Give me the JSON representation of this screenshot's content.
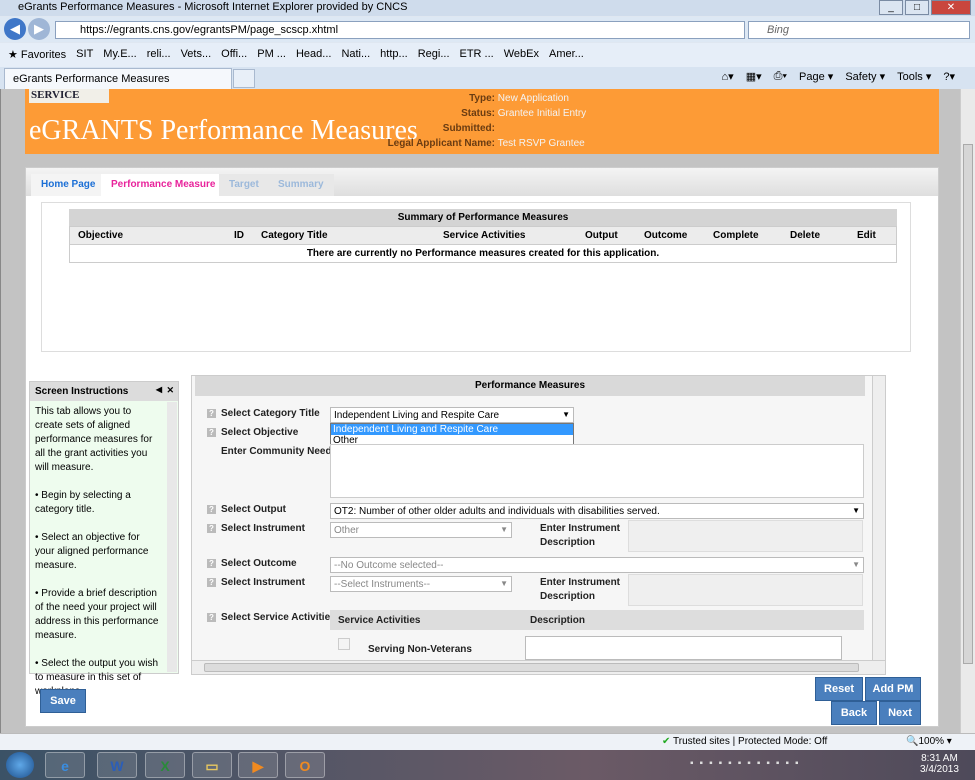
{
  "browser": {
    "title": "eGrants Performance Measures - Microsoft Internet Explorer provided by CNCS",
    "url": "https://egrants.cns.gov/egrantsPM/page_scscp.xhtml",
    "search_placeholder": "Bing",
    "tab_title": "eGrants Performance Measures",
    "favorites_label": "Favorites",
    "favorites": [
      "SIT",
      "My.E...",
      "reli...",
      "Vets...",
      "Offi...",
      "PM ...",
      "Head...",
      "Nati...",
      "http...",
      "Regi...",
      "ETR ...",
      "WebEx",
      "Amer..."
    ],
    "commands": [
      "Page ▾",
      "Safety ▾",
      "Tools ▾"
    ]
  },
  "banner": {
    "logo": "SERVICE",
    "title": "eGRANTS Performance Measures",
    "type_label": "Type:",
    "type": "New Application",
    "status_label": "Status:",
    "status": "Grantee Initial Entry",
    "submitted_label": "Submitted:",
    "submitted": "",
    "applicant_label": "Legal Applicant Name:",
    "applicant": "Test RSVP Grantee"
  },
  "tabs": [
    "Home Page",
    "Performance Measure",
    "Target",
    "Summary"
  ],
  "summary": {
    "title": "Summary of Performance Measures",
    "columns": [
      "Objective",
      "ID",
      "Category Title",
      "Service Activities",
      "Output",
      "Outcome",
      "Complete",
      "Delete",
      "Edit"
    ],
    "empty": "There are currently no Performance measures created for this application."
  },
  "instructions": {
    "title": "Screen Instructions",
    "paragraphs": [
      "This tab allows you to create sets of aligned performance measures for all the grant activities you will measure.",
      "• Begin by selecting a category title.",
      "• Select an objective for your aligned performance measure.",
      "• Provide a brief description of the need your project will address in this performance measure.",
      "• Select the output you wish to measure in this set of workplans."
    ]
  },
  "form": {
    "title": "Performance Measures",
    "category_label": "Select Category Title",
    "category_value": "Independent Living and Respite Care",
    "category_options": [
      "Independent Living and Respite Care",
      "Other"
    ],
    "objective_label": "Select Objective",
    "need_label": "Enter Community Need",
    "output_label": "Select Output",
    "output_value": "OT2: Number of other older adults and individuals with disabilities served.",
    "instrument_label": "Select Instrument",
    "instrument1_value": "Other",
    "instr_desc_label": "Enter Instrument Description",
    "outcome_label": "Select Outcome",
    "outcome_value": "--No Outcome selected--",
    "instrument2_value": "--Select Instruments--",
    "activities_label": "Select Service Activities",
    "activities_col1": "Service Activities",
    "activities_col2": "Description",
    "activity1": "Serving Non-Veterans"
  },
  "buttons": {
    "save": "Save",
    "reset": "Reset",
    "add_pm": "Add PM",
    "back": "Back",
    "next": "Next"
  },
  "statusbar": {
    "zone": "Trusted sites | Protected Mode: Off",
    "zoom": "100%"
  },
  "taskbar": {
    "time": "8:31 AM",
    "date": "3/4/2013"
  }
}
